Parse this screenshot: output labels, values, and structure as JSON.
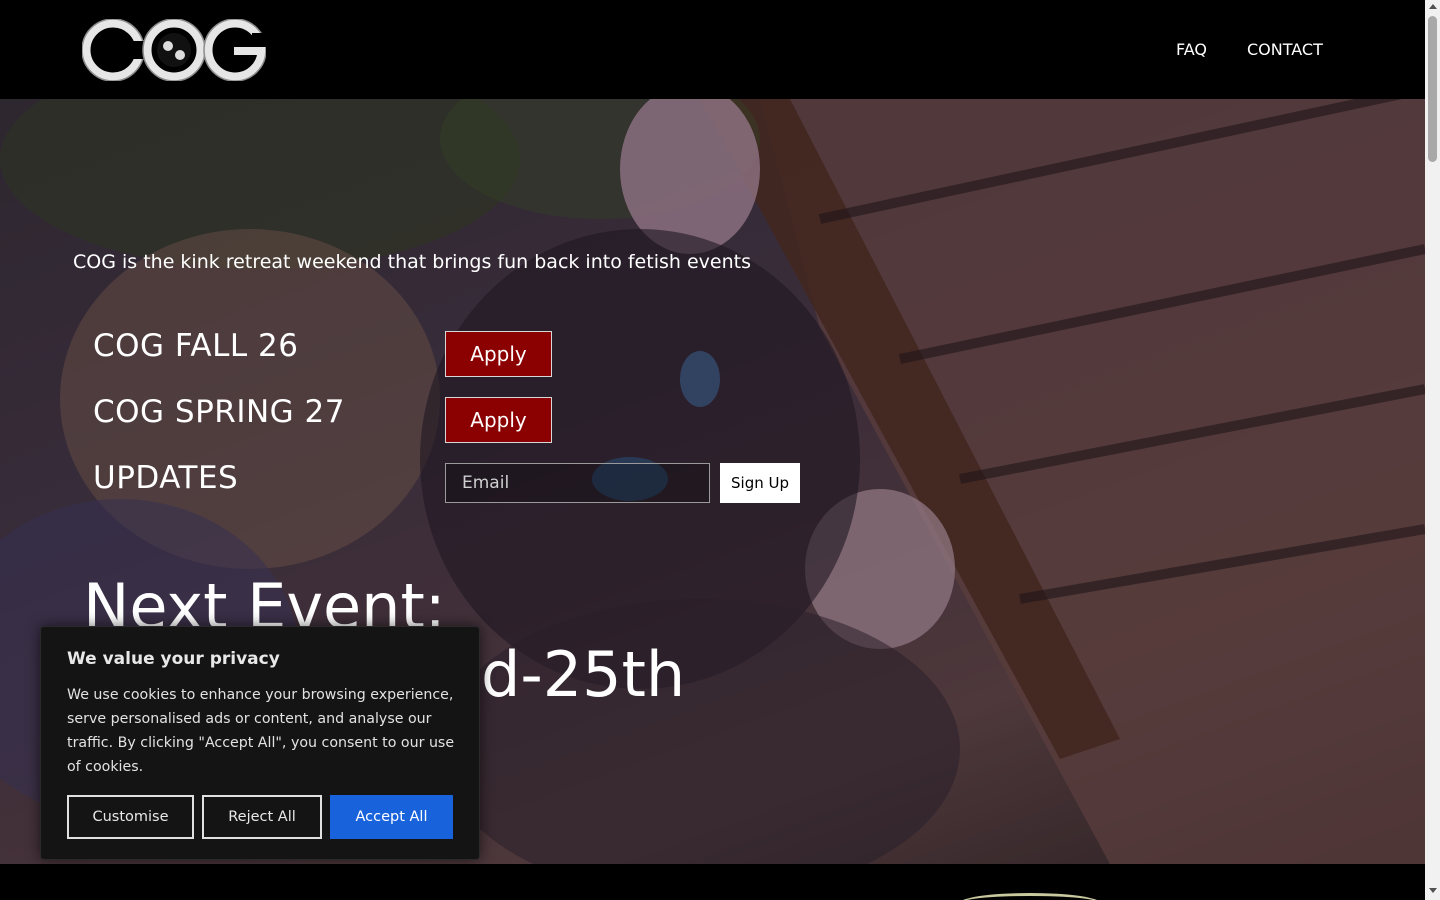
{
  "header": {
    "logo_text": "COG",
    "nav": [
      {
        "label": "FAQ"
      },
      {
        "label": "CONTACT"
      }
    ]
  },
  "hero": {
    "tagline": "COG is the kink retreat weekend that brings fun back into fetish events",
    "events": [
      {
        "label": "COG FALL 26",
        "button": "Apply"
      },
      {
        "label": "COG SPRING 27",
        "button": "Apply"
      }
    ],
    "updates": {
      "label": "UPDATES",
      "email_placeholder": "Email",
      "signup_label": "Sign Up"
    },
    "next_event_title": "Next Event:",
    "next_event_date": "d-25th"
  },
  "cookie_banner": {
    "title": "We value your privacy",
    "text": "We use cookies to enhance your browsing experience, serve personalised ads or content, and analyse our traffic. By clicking \"Accept All\", you consent to our use of cookies.",
    "customise_label": "Customise",
    "reject_label": "Reject All",
    "accept_label": "Accept All",
    "accept_color": "#1863dc"
  },
  "colors": {
    "apply_button": "#8b0000",
    "header_bg": "#000000"
  }
}
